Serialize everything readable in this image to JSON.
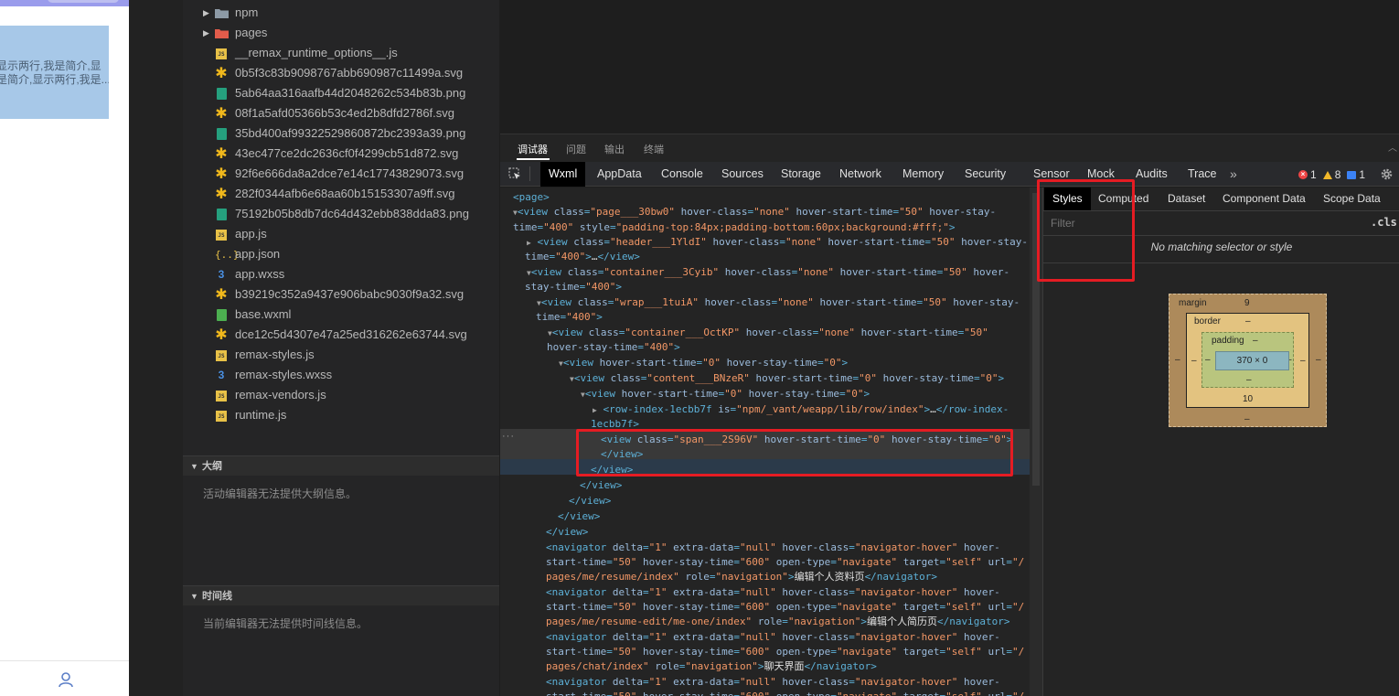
{
  "simulator": {
    "card_line1": "显示两行,我是简介,显",
    "card_line2": "是简介,显示两行,我是...",
    "nav_user_icon": "user-icon"
  },
  "explorer": {
    "files": [
      {
        "label": "npm",
        "icon": "folder-icon",
        "expandable": true
      },
      {
        "label": "pages",
        "icon": "folder-pages-icon",
        "expandable": true
      },
      {
        "label": "__remax_runtime_options__.js",
        "icon": "js-file-icon"
      },
      {
        "label": "0b5f3c83b9098767abb690987c11499a.svg",
        "icon": "svg-file-icon"
      },
      {
        "label": "5ab64aa316aafb44d2048262c534b83b.png",
        "icon": "png-file-icon"
      },
      {
        "label": "08f1a5afd05366b53c4ed2b8dfd2786f.svg",
        "icon": "svg-file-icon"
      },
      {
        "label": "35bd400af99322529860872bc2393a39.png",
        "icon": "png-file-icon"
      },
      {
        "label": "43ec477ce2dc2636cf0f4299cb51d872.svg",
        "icon": "svg-file-icon"
      },
      {
        "label": "92f6e666da8a2dce7e14c17743829073.svg",
        "icon": "svg-file-icon"
      },
      {
        "label": "282f0344afb6e68aa60b15153307a9ff.svg",
        "icon": "svg-file-icon"
      },
      {
        "label": "75192b05b8db7dc64d432ebb838dda83.png",
        "icon": "png-file-icon"
      },
      {
        "label": "app.js",
        "icon": "js-file-icon"
      },
      {
        "label": "app.json",
        "icon": "json-file-icon"
      },
      {
        "label": "app.wxss",
        "icon": "css-file-icon"
      },
      {
        "label": "b39219c352a9437e906babc9030f9a32.svg",
        "icon": "svg-file-icon"
      },
      {
        "label": "base.wxml",
        "icon": "wxml-file-icon"
      },
      {
        "label": "dce12c5d4307e47a25ed316262e63744.svg",
        "icon": "svg-file-icon"
      },
      {
        "label": "remax-styles.js",
        "icon": "js-file-icon"
      },
      {
        "label": "remax-styles.wxss",
        "icon": "css-file-icon"
      },
      {
        "label": "remax-vendors.js",
        "icon": "js-file-icon"
      },
      {
        "label": "runtime.js",
        "icon": "js-file-icon"
      }
    ],
    "outline": {
      "title": "大纲",
      "message": "活动编辑器无法提供大纲信息。"
    },
    "timeline": {
      "title": "时间线",
      "message": "当前编辑器无法提供时间线信息。"
    }
  },
  "debugger": {
    "tabs": [
      "调试器",
      "问题",
      "输出",
      "终端"
    ],
    "active_tab": "调试器",
    "devtools_tabs": [
      "Wxml",
      "AppData",
      "Console",
      "Sources",
      "Storage",
      "Network",
      "Memory",
      "Security",
      "Sensor",
      "Mock",
      "Audits",
      "Trace"
    ],
    "active_devtools_tab": "Wxml",
    "more": "»",
    "errors": "1",
    "warnings": "8",
    "messages": "1"
  },
  "styles_pane": {
    "tabs": [
      "Styles",
      "Computed",
      "Dataset",
      "Component Data",
      "Scope Data"
    ],
    "active_tab": "Styles",
    "filter_placeholder": "Filter",
    "cls": ".cls",
    "empty_message": "No matching selector or style",
    "box_model": {
      "margin_label": "margin",
      "margin_top": "9",
      "margin_bottom": "–",
      "margin_left": "–",
      "margin_right": "–",
      "border_label": "border",
      "border_top": "–",
      "border_bottom": "10",
      "border_left": "–",
      "border_right": "–",
      "padding_label": "padding",
      "padding_top": "–",
      "padding_bottom": "–",
      "padding_left": "–",
      "padding_right": "–",
      "content": "370 × 0"
    }
  },
  "colors": {
    "highlight": "#e51c23",
    "tag": "#5db0d7",
    "attr_name": "#9bbbdc",
    "attr_value": "#f29766"
  }
}
